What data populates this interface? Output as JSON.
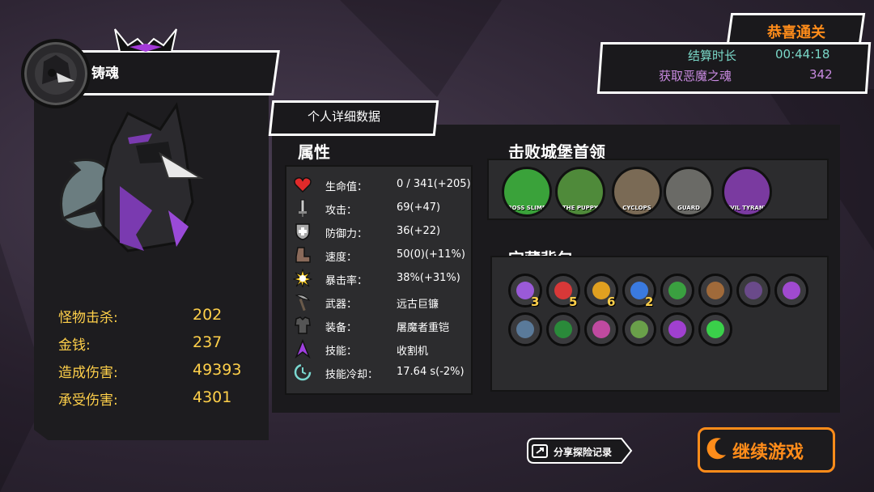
{
  "player": {
    "name": "铸魂",
    "stats": [
      {
        "label": "怪物击杀:",
        "value": "202"
      },
      {
        "label": "金钱:",
        "value": "237"
      },
      {
        "label": "造成伤害:",
        "value": "49393"
      },
      {
        "label": "承受伤害:",
        "value": "4301"
      }
    ]
  },
  "detail_tab": {
    "label": "个人详细数据"
  },
  "attributes": {
    "title": "属性",
    "rows": [
      {
        "icon": "heart-icon",
        "label": "生命值：",
        "value": "0 / 341(+205)"
      },
      {
        "icon": "sword-icon",
        "label": "攻击：",
        "value": "69(+47)"
      },
      {
        "icon": "shield-icon",
        "label": "防御力：",
        "value": "36(+22)"
      },
      {
        "icon": "boot-icon",
        "label": "速度：",
        "value": "50(0)(+11%)"
      },
      {
        "icon": "burst-icon",
        "label": "暴击率：",
        "value": "38%(+31%)"
      },
      {
        "icon": "weapon-icon",
        "label": "武器：",
        "value": "远古巨镰"
      },
      {
        "icon": "armor-icon",
        "label": "装备：",
        "value": "屠魔者重铠"
      },
      {
        "icon": "skill-icon",
        "label": "技能：",
        "value": "收割机"
      },
      {
        "icon": "cooldown-icon",
        "label": "技能冷却：",
        "value": "17.64 s(-2%)"
      }
    ]
  },
  "bosses": {
    "title": "击败城堡首领",
    "items": [
      {
        "label": "BOSS SLIME",
        "color": "#3aa23a"
      },
      {
        "label": "THE PUPPY",
        "color": "#4f8a3a"
      },
      {
        "label": "CYCLOPS",
        "color": "#7a6a55"
      },
      {
        "label": "GUARD",
        "color": "#6a6a66"
      },
      {
        "label": "EVIL TYRANT",
        "color": "#7a3aa0"
      }
    ]
  },
  "treasure": {
    "title": "宝藏背包",
    "items": [
      {
        "icon": "purple-crystal-icon",
        "color": "#9a5ad8",
        "count": "3"
      },
      {
        "icon": "red-gem-icon",
        "color": "#d83838",
        "count": "5"
      },
      {
        "icon": "amber-gem-icon",
        "color": "#e0a020",
        "count": "6"
      },
      {
        "icon": "blue-crystal-icon",
        "color": "#3a7ae0",
        "count": "2"
      },
      {
        "icon": "green-dragon-icon",
        "color": "#3aa040",
        "count": ""
      },
      {
        "icon": "meat-icon",
        "color": "#a06a3a",
        "count": ""
      },
      {
        "icon": "dark-cat-icon",
        "color": "#6a4a8a",
        "count": ""
      },
      {
        "icon": "scroll-icon",
        "color": "#a04ad0",
        "count": ""
      },
      {
        "icon": "ankh-icon",
        "color": "#5a7a9a",
        "count": ""
      },
      {
        "icon": "green-blob-icon",
        "color": "#2a8a3a",
        "count": ""
      },
      {
        "icon": "flower-icon",
        "color": "#c04aa0",
        "count": ""
      },
      {
        "icon": "green-orb-icon",
        "color": "#6aa04a",
        "count": ""
      },
      {
        "icon": "purple-ring-icon",
        "color": "#a040d0",
        "count": ""
      },
      {
        "icon": "green-spirit-icon",
        "color": "#3ad04a",
        "count": ""
      }
    ]
  },
  "congrats": {
    "title": "恭喜通关",
    "rows": [
      {
        "label": "结算时长",
        "value": "00:44:18",
        "color": "#7ad8c8"
      },
      {
        "label": "获取恶魔之魂",
        "value": "342",
        "color": "#c88ae0"
      }
    ]
  },
  "buttons": {
    "share": "分享探险记录",
    "continue": "继续游戏"
  },
  "colors": {
    "accent": "#ff8c1a",
    "stat": "#ffd04a",
    "teal": "#7ad8c8",
    "purple": "#c88ae0"
  }
}
